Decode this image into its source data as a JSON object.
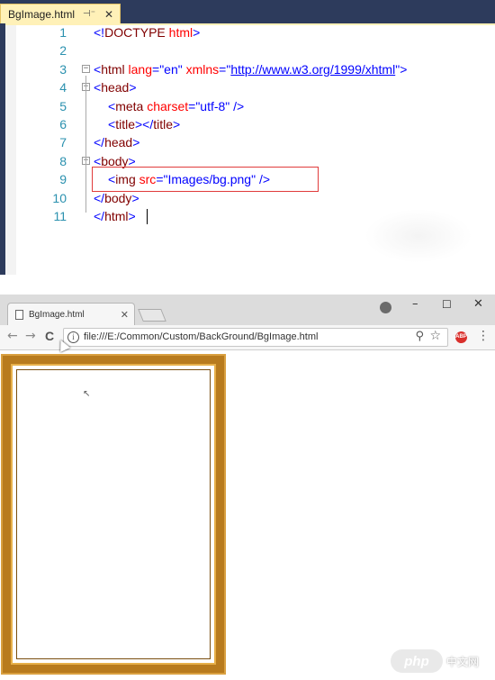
{
  "editor": {
    "tab": {
      "filename": "BgImage.html",
      "pin_icon": "pin-icon",
      "close_icon": "close-icon"
    },
    "lines": [
      {
        "num": "1",
        "tokens": [
          [
            "br",
            "<!"
          ],
          [
            "tag",
            "DOCTYPE "
          ],
          [
            "attr",
            "html"
          ],
          [
            "br",
            ">"
          ]
        ]
      },
      {
        "num": "2",
        "tokens": []
      },
      {
        "num": "3",
        "tokens": [
          [
            "br",
            "<"
          ],
          [
            "tag",
            "html "
          ],
          [
            "attr",
            "lang"
          ],
          [
            "eq",
            "="
          ],
          [
            "val",
            "\"en\" "
          ],
          [
            "attr",
            "xmlns"
          ],
          [
            "eq",
            "="
          ],
          [
            "val",
            "\""
          ],
          [
            "link",
            "http://www.w3.org/1999/xhtml"
          ],
          [
            "val",
            "\""
          ],
          [
            "br",
            ">"
          ]
        ]
      },
      {
        "num": "4",
        "tokens": [
          [
            "br",
            "<"
          ],
          [
            "tag",
            "head"
          ],
          [
            "br",
            ">"
          ]
        ]
      },
      {
        "num": "5",
        "tokens": [
          [
            "br",
            "<"
          ],
          [
            "tag",
            "meta "
          ],
          [
            "attr",
            "charset"
          ],
          [
            "eq",
            "="
          ],
          [
            "val",
            "\"utf-8\" "
          ],
          [
            "br",
            "/>"
          ]
        ]
      },
      {
        "num": "6",
        "tokens": [
          [
            "br",
            "<"
          ],
          [
            "tag",
            "title"
          ],
          [
            "br",
            "></"
          ],
          [
            "tag",
            "title"
          ],
          [
            "br",
            ">"
          ]
        ]
      },
      {
        "num": "7",
        "tokens": [
          [
            "br",
            "</"
          ],
          [
            "tag",
            "head"
          ],
          [
            "br",
            ">"
          ]
        ]
      },
      {
        "num": "8",
        "tokens": [
          [
            "br",
            "<"
          ],
          [
            "tag",
            "body"
          ],
          [
            "br",
            ">"
          ]
        ]
      },
      {
        "num": "9",
        "tokens": [
          [
            "br",
            "<"
          ],
          [
            "tag",
            "img "
          ],
          [
            "attr",
            "src"
          ],
          [
            "eq",
            "="
          ],
          [
            "val",
            "\"Images/bg.png\" "
          ],
          [
            "br",
            "/>"
          ]
        ]
      },
      {
        "num": "10",
        "tokens": [
          [
            "br",
            "</"
          ],
          [
            "tag",
            "body"
          ],
          [
            "br",
            ">"
          ]
        ]
      },
      {
        "num": "11",
        "tokens": [
          [
            "br",
            "</"
          ],
          [
            "tag",
            "html"
          ],
          [
            "br",
            ">"
          ]
        ]
      }
    ]
  },
  "browser": {
    "tab_title": "BgImage.html",
    "url": "file:///E:/Common/Custom/BackGround/BgImage.html",
    "window_buttons": {
      "minimize": "–",
      "maximize": "☐",
      "close": "✕"
    },
    "nav": {
      "back": "←",
      "forward": "→",
      "reload": "C"
    },
    "extension_label": "ABP"
  },
  "watermark": {
    "logo": "php",
    "text": "中文网"
  },
  "colors": {
    "tag": "#800000",
    "attr": "#ff0000",
    "value": "#0000ff",
    "line_number": "#2b91af",
    "frame": "#b87b1e"
  }
}
